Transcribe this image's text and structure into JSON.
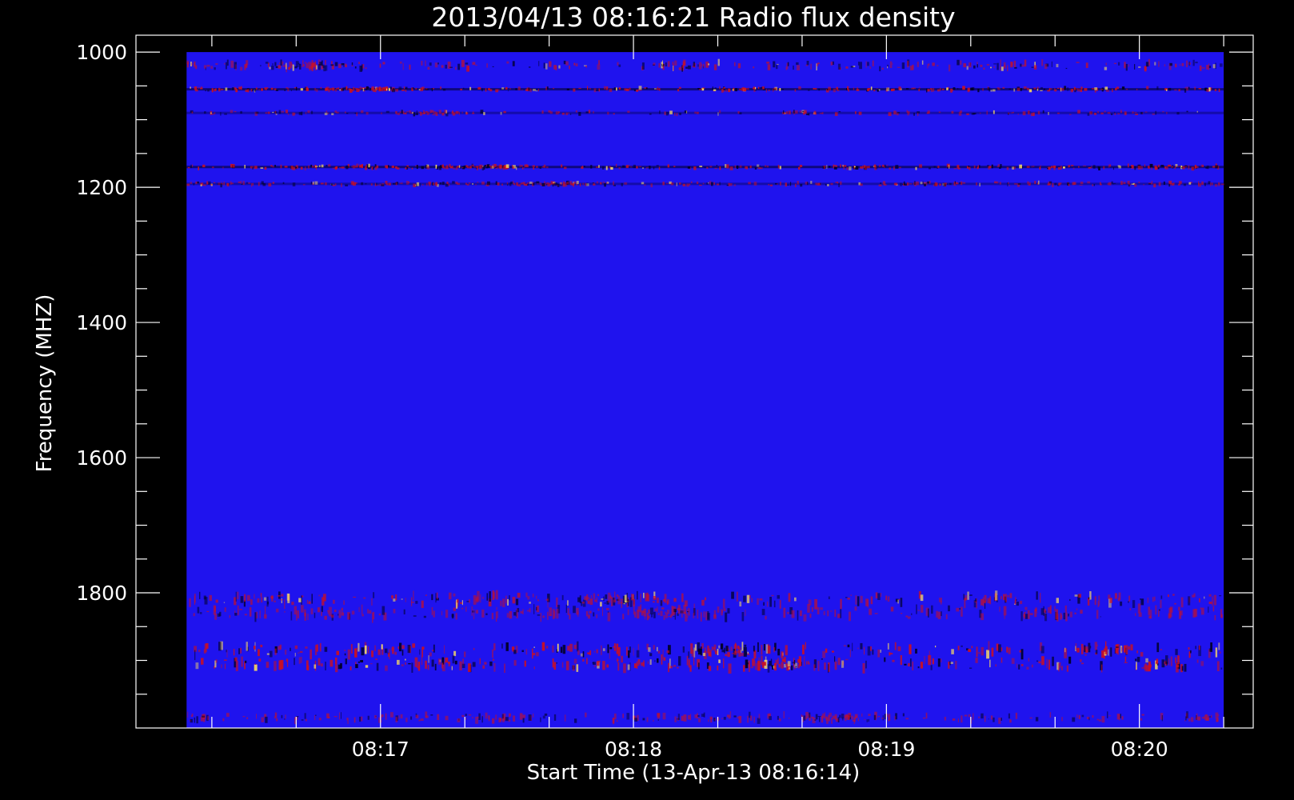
{
  "chart_data": {
    "type": "heatmap",
    "title": "2013/04/13 08:16:21 Radio flux density",
    "xlabel": "Start Time (13-Apr-13 08:16:14)",
    "ylabel": "Frequency (MHZ)",
    "x_start": "08:16:14",
    "x_end": "08:20:20",
    "xlim": [
      "08:16:02",
      "08:20:27"
    ],
    "x_major_ticks": [
      "08:17",
      "08:18",
      "08:19",
      "08:20"
    ],
    "x_minor_step_seconds": 20,
    "ylim": [
      975,
      2000
    ],
    "y_data_range": [
      1000,
      2000
    ],
    "y_major_ticks": [
      1000,
      1200,
      1400,
      1600,
      1800
    ],
    "y_minor_step": 50,
    "y_inverted": true,
    "grid": false,
    "colormap": {
      "background": "#1f13ee",
      "low": "#000020",
      "mid": "#cc1020",
      "high": "#ffe060"
    },
    "bands": [
      {
        "frequency": 1020,
        "intensity": "moderate",
        "style": "speckle"
      },
      {
        "frequency": 1055,
        "intensity": "strong",
        "style": "line"
      },
      {
        "frequency": 1090,
        "intensity": "moderate",
        "style": "dashed"
      },
      {
        "frequency": 1170,
        "intensity": "strong",
        "style": "line"
      },
      {
        "frequency": 1195,
        "intensity": "moderate",
        "style": "line"
      },
      {
        "frequency": 1810,
        "intensity": "moderate",
        "style": "patchy"
      },
      {
        "frequency": 1830,
        "intensity": "weak",
        "style": "patchy"
      },
      {
        "frequency": 1885,
        "intensity": "strong",
        "style": "patchy"
      },
      {
        "frequency": 1905,
        "intensity": "strong",
        "style": "patchy"
      },
      {
        "frequency": 1985,
        "intensity": "weak",
        "style": "speckle"
      }
    ]
  }
}
